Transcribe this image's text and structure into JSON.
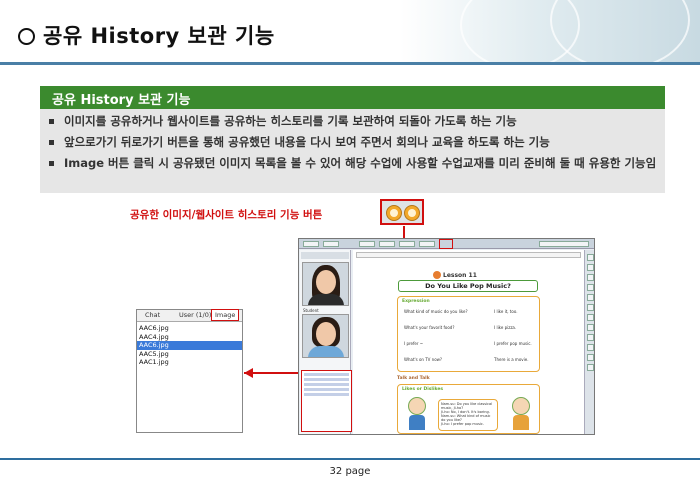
{
  "header": {
    "title": "공유 History 보관 기능"
  },
  "section": {
    "title": "공유 History 보관 기능",
    "bullets": [
      "이미지를 공유하거나 웹사이트를 공유하는 히스토리를 기록 보관하여 되돌아 가도록 하는 기능",
      "앞으로가기 뒤로가기 버튼을 통해 공유했던 내용을 다시 보여 주면서 회의나 교육을 하도록 하는 기능",
      "Image 버튼 클릭 시 공유됐던 이미지 목록을 볼 수 있어 해당 수업에 사용할 수업교재를 미리 준비해 둘 때 유용한 기능임"
    ]
  },
  "callout": {
    "label": "공유한 이미지/웹사이트 히스토리 기능 버튼"
  },
  "image_panel": {
    "tabs": [
      "Chat",
      "User (1/0)",
      "Image"
    ],
    "active_tab": "Image",
    "items": [
      "AAC6.jpg",
      "AAC4.jpg",
      "AAC6.jpg",
      "AAC5.jpg",
      "AAC1.jpg"
    ],
    "selected_index": 2
  },
  "app": {
    "left_labels": [
      "Student"
    ],
    "lesson": "Lesson 11",
    "song_title": "Do You Like Pop Music?",
    "expression_tag": "Expression",
    "expression_lines": [
      "What kind of music do you like?",
      "I like it, too.",
      "What's your favorit food?",
      "I like pizza.",
      "I prefer ~",
      "I prefer pop music.",
      "What's on TV now?",
      "There is a movie."
    ],
    "talk_tag": "Talk and Talk",
    "likes_tag": "Likes or Dislikes",
    "bubble_lines": [
      "Nam-su: Do you like classical music, Ji-ho?",
      "Ji-ho: No, I don't. It's boring.",
      "Nam-su: What kind of music do you like?",
      "Ji-ho: I prefer pop music."
    ]
  },
  "footer": {
    "page": "32 page"
  },
  "colors": {
    "section_bar": "#3b8a2e",
    "accent_red": "#d10f0f",
    "header_line": "#4a7fa6",
    "selected_item": "#3a7ad9"
  }
}
